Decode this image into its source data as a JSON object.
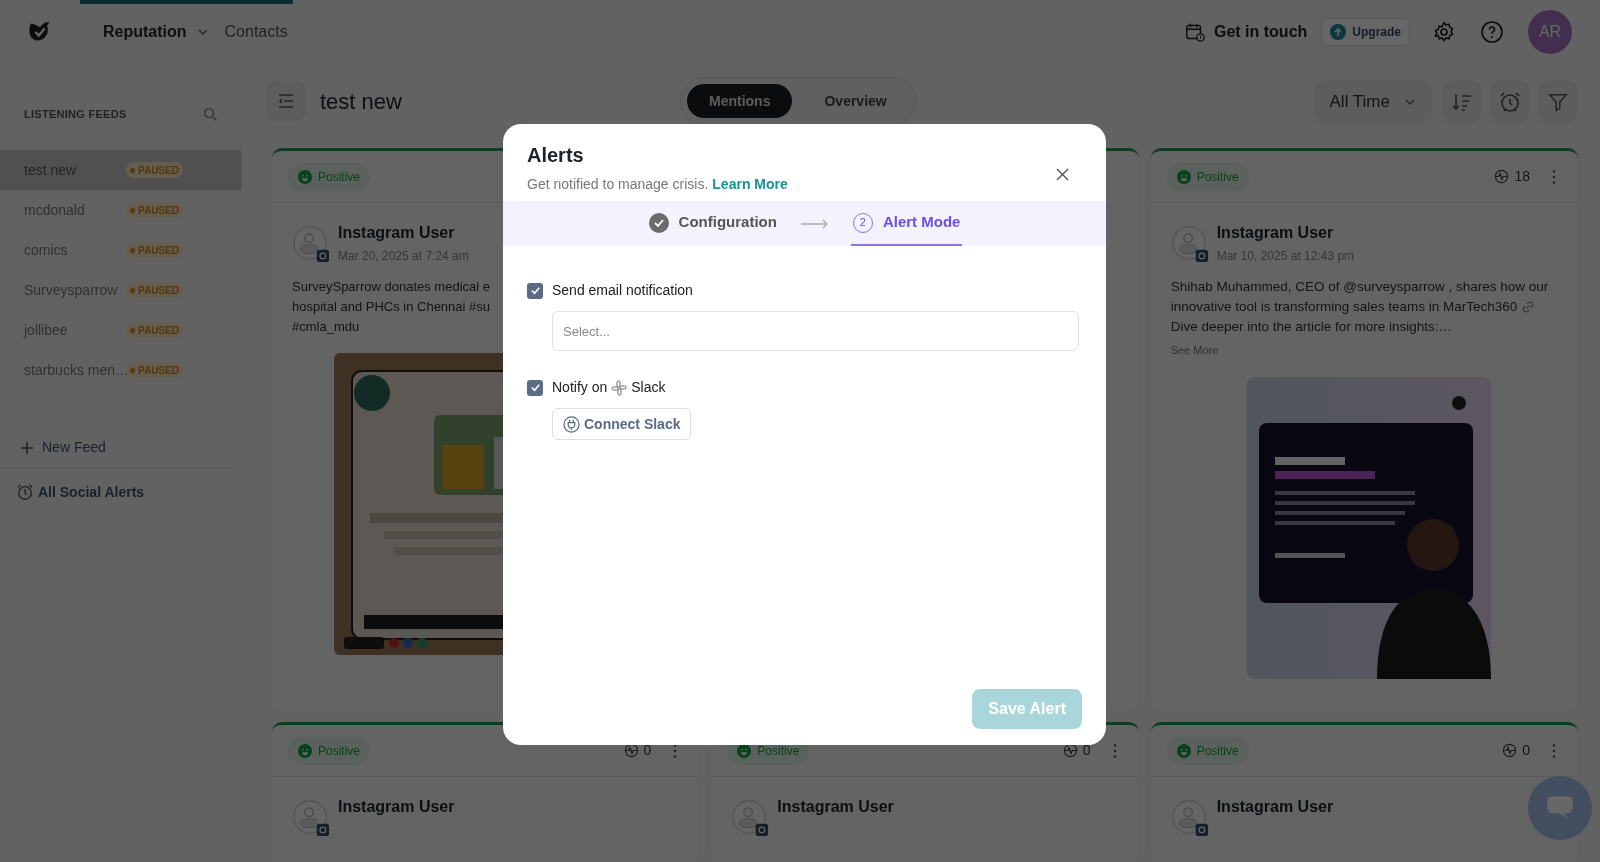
{
  "nav": {
    "items": [
      {
        "label": "Reputation",
        "selected": true,
        "has_menu": true
      },
      {
        "label": "Contacts",
        "selected": false,
        "has_menu": false
      }
    ],
    "get_in_touch": "Get in touch",
    "upgrade": "Upgrade",
    "avatar_initials": "AR"
  },
  "sidebar": {
    "title": "LISTENING FEEDS",
    "feeds": [
      {
        "name": "test new",
        "status": "PAUSED",
        "selected": true
      },
      {
        "name": "mcdonald",
        "status": "PAUSED",
        "selected": false
      },
      {
        "name": "comics",
        "status": "PAUSED",
        "selected": false
      },
      {
        "name": "Surveysparrow",
        "status": "PAUSED",
        "selected": false
      },
      {
        "name": "jollibee",
        "status": "PAUSED",
        "selected": false
      },
      {
        "name": "starbucks men…",
        "status": "PAUSED",
        "selected": false
      }
    ],
    "new_feed": "New Feed",
    "all_alerts": "All Social Alerts"
  },
  "toolbar": {
    "title": "test new",
    "tabs": [
      {
        "label": "Mentions",
        "selected": true
      },
      {
        "label": "Overview",
        "selected": false
      }
    ],
    "period": "All Time"
  },
  "top_cards": [
    {
      "sentiment": "Positive",
      "user": "Instagram User",
      "date": "Mar 20, 2025 at 7:24 am",
      "lines": [
        "SurveySparrow donates medical e",
        "hospital and PHCs in Chennai #su",
        "#cmla_mdu"
      ]
    },
    {
      "sentiment": "Positive",
      "count": "18",
      "user": "Instagram User",
      "date": "Mar 10, 2025 at 12:43 pm",
      "lines": [
        {
          "text": "Shihab Muhammed, CEO of @surveysparrow , shares how our",
          "link": false
        },
        {
          "text": "innovative tool is transforming sales teams in MarTech360",
          "link": true
        },
        {
          "text": "Dive deeper into the article for more insights:…",
          "link": false
        }
      ],
      "see_more": "See More"
    }
  ],
  "bottom_cards": [
    {
      "sentiment": "Positive",
      "count": "0",
      "user": "Instagram User"
    },
    {
      "sentiment": "Positive",
      "count": "0",
      "user": "Instagram User"
    },
    {
      "sentiment": "Positive",
      "count": "0",
      "user": "Instagram User"
    }
  ],
  "modal": {
    "title": "Alerts",
    "subtitle": "Get notified to manage crisis.",
    "link": "Learn More",
    "steps": [
      {
        "label": "Configuration",
        "done": true,
        "selected": false
      },
      {
        "label": "Alert Mode",
        "number": "2",
        "done": false,
        "selected": true
      }
    ],
    "options": [
      {
        "label_1": "Send email notification",
        "checked": true,
        "placeholder": "Select..."
      },
      {
        "label_1": "Notify on",
        "label_2": "Slack",
        "checked": true,
        "button": "Connect Slack"
      }
    ],
    "save": {
      "label": "Save Alert",
      "disabled": true
    }
  }
}
